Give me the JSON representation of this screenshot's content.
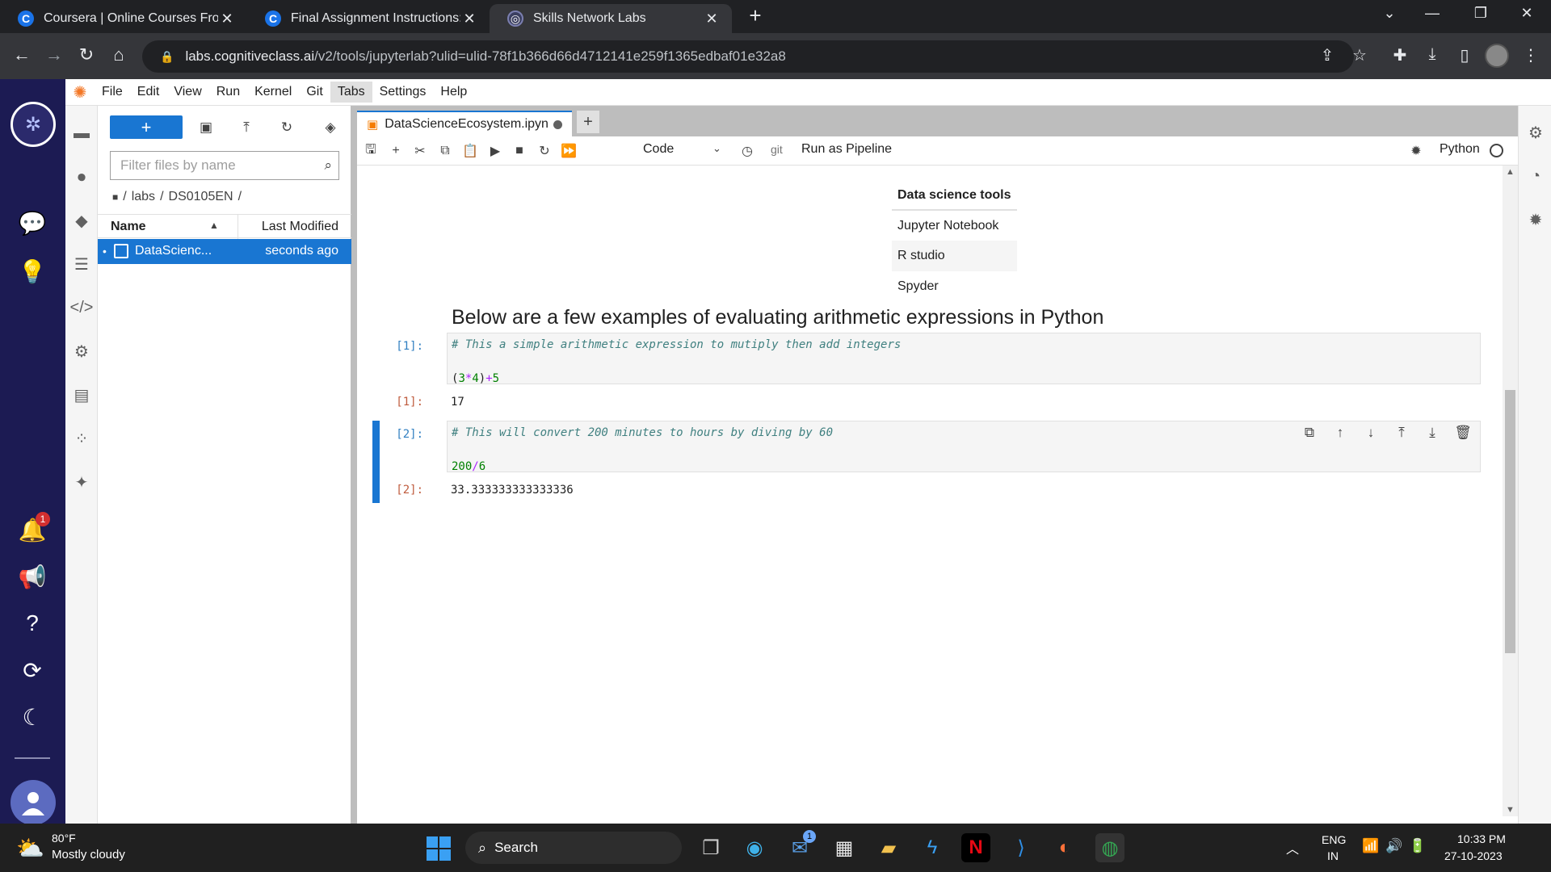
{
  "browser": {
    "tabs": [
      {
        "favicon": "C",
        "label": "Coursera | Online Courses From",
        "close": "✕"
      },
      {
        "favicon": "C",
        "label": "Final Assignment Instructions: Cr",
        "close": "✕"
      },
      {
        "favicon": "◎",
        "label": "Skills Network Labs",
        "close": "✕"
      }
    ],
    "new_tab": "+",
    "window_controls": {
      "tab_search": "⌄",
      "minimize": "—",
      "restore": "❐",
      "close": "✕"
    },
    "url_host": "labs.cognitiveclass.ai",
    "url_path": "/v2/tools/jupyterlab?ulid=ulid-78f1b366d66d4712141e259f1365edbaf01e32a8"
  },
  "menu": [
    "File",
    "Edit",
    "View",
    "Run",
    "Kernel",
    "Git",
    "Tabs",
    "Settings",
    "Help"
  ],
  "active_menu_index": 6,
  "navy_sidebar": {
    "notification_count": "1"
  },
  "file_browser": {
    "new_button": "+",
    "filter_placeholder": "Filter files by name",
    "breadcrumb": [
      "/",
      "labs",
      "/",
      "DS0105EN",
      "/"
    ],
    "columns": {
      "name": "Name",
      "modified": "Last Modified"
    },
    "files": [
      {
        "name": "DataScienc...",
        "modified": "seconds ago"
      }
    ]
  },
  "document": {
    "tab_label": "DataScienceEcosystem.ipyn",
    "add_tab": "+",
    "toolbar": {
      "cell_type": "Code",
      "git": "git",
      "pipeline": "Run as Pipeline",
      "kernel": "Python"
    }
  },
  "notebook": {
    "table": {
      "header": "Data science tools",
      "rows": [
        "Jupyter Notebook",
        "R studio",
        "Spyder"
      ]
    },
    "heading": "Below are a few examples of evaluating arithmetic expressions in Python",
    "cells": [
      {
        "in_prompt": "[1]:",
        "comment": "# This a simple arithmetic expression to mutiply then add integers",
        "code_parts": [
          "(",
          "3",
          "*",
          "4",
          ")",
          "+",
          "5"
        ],
        "out_prompt": "[1]:",
        "output": "17"
      },
      {
        "in_prompt": "[2]:",
        "comment": "# This will convert 200 minutes to hours by diving by 60",
        "code_parts": [
          "200",
          "/",
          "6"
        ],
        "out_prompt": "[2]:",
        "output": "33.333333333333336"
      }
    ]
  },
  "taskbar": {
    "temperature": "80°F",
    "weather": "Mostly cloudy",
    "search": "Search",
    "mail_badge": "1",
    "lang_top": "ENG",
    "lang_bottom": "IN",
    "time": "10:33 PM",
    "date": "27-10-2023"
  },
  "colors": {
    "accent": "#1976d2",
    "navy": "#1c1b53",
    "tabbar": "#202124"
  }
}
